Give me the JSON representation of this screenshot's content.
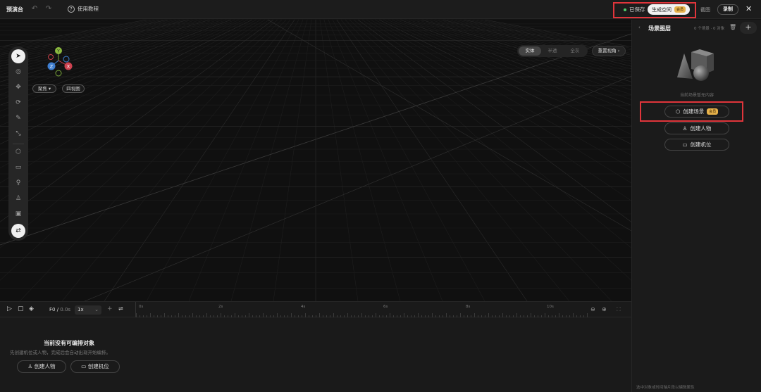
{
  "topbar": {
    "title": "预演台",
    "help_label": "使用教程",
    "saved_label": "已保存",
    "generate_label": "生成空间",
    "generate_badge": "会员",
    "screenshot_label": "截图",
    "record_label": "录制",
    "highlight_color": "#e0353b"
  },
  "viewport": {
    "gizmo": {
      "y": "Y",
      "x": "X",
      "z": "Z"
    },
    "focus_label": "聚焦",
    "quad_view_label": "四视图",
    "modes": [
      "实体",
      "半透",
      "全灰"
    ],
    "active_mode": "实体",
    "reset_view_label": "重置视角"
  },
  "timeline": {
    "time_current": "F0",
    "time_total": "0.0s",
    "speed": "1x",
    "ticks": [
      "0s",
      "2s",
      "4s",
      "6s",
      "8s",
      "10s"
    ],
    "empty_title": "当前没有可编排对象",
    "empty_desc": "先创建机位或人物，完成后会自动出现开始编排。",
    "create_person_label": "创建人物",
    "create_camera_label": "创建机位"
  },
  "panel": {
    "title": "场景图层",
    "count": "0 个场景 · 0 对象",
    "empty_text": "当前场景暂无内容",
    "create_scene_label": "创建场景",
    "create_scene_badge": "会员",
    "create_person_label": "创建人物",
    "create_camera_label": "创建机位",
    "footer_hint": "选中对象或时间轴片段以编辑属性"
  }
}
